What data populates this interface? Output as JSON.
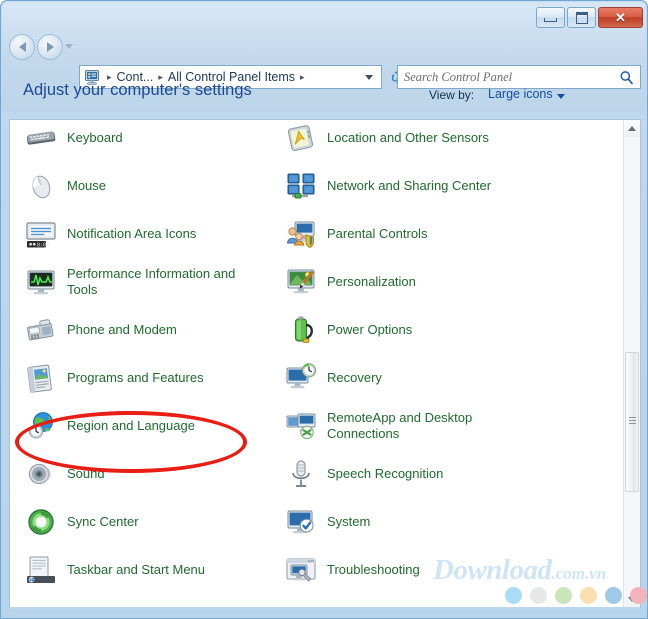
{
  "window": {
    "frame_color": "#bcd6ec",
    "border_color": "#6fa8d4",
    "buttons": {
      "minimize_label": "Minimize",
      "maximize_label": "Maximize",
      "close_label": "✕"
    }
  },
  "navigation": {
    "back_label": "Back",
    "forward_label": "Forward",
    "recent_pages_label": "Recent pages",
    "refresh_label": "Refresh",
    "breadcrumb": {
      "icon": "control-panel-icon",
      "separator": "▸",
      "items": [
        {
          "label": "Cont..."
        },
        {
          "label": "All Control Panel Items"
        }
      ]
    },
    "address_dropdown_label": "Previous locations"
  },
  "search": {
    "placeholder": "Search Control Panel",
    "icon": "search-icon"
  },
  "header": {
    "title": "Adjust your computer's settings",
    "view_by_label": "View by:",
    "view_by_value": "Large icons",
    "view_by_caret": "▾",
    "title_color": "#1b4a91",
    "link_color": "#12519e"
  },
  "content": {
    "item_label_color": "#1f6b2e",
    "items": [
      {
        "label": "Keyboard",
        "icon": "keyboard-icon",
        "column": "left"
      },
      {
        "label": "Location and Other Sensors",
        "icon": "location-sensor-icon",
        "column": "right"
      },
      {
        "label": "Mouse",
        "icon": "mouse-icon",
        "column": "left"
      },
      {
        "label": "Network and Sharing Center",
        "icon": "network-sharing-icon",
        "column": "right"
      },
      {
        "label": "Notification Area Icons",
        "icon": "notification-area-icon",
        "column": "left"
      },
      {
        "label": "Parental Controls",
        "icon": "parental-controls-icon",
        "column": "right"
      },
      {
        "label": "Performance Information and Tools",
        "icon": "performance-icon",
        "column": "left"
      },
      {
        "label": "Personalization",
        "icon": "personalization-icon",
        "column": "right"
      },
      {
        "label": "Phone and Modem",
        "icon": "phone-modem-icon",
        "column": "left"
      },
      {
        "label": "Power Options",
        "icon": "power-options-icon",
        "column": "right"
      },
      {
        "label": "Programs and Features",
        "icon": "programs-features-icon",
        "column": "left"
      },
      {
        "label": "Recovery",
        "icon": "recovery-icon",
        "column": "right"
      },
      {
        "label": "Region and Language",
        "icon": "region-language-icon",
        "column": "left"
      },
      {
        "label": "RemoteApp and Desktop Connections",
        "icon": "remoteapp-icon",
        "column": "right"
      },
      {
        "label": "Sound",
        "icon": "sound-icon",
        "column": "left"
      },
      {
        "label": "Speech Recognition",
        "icon": "speech-recognition-icon",
        "column": "right"
      },
      {
        "label": "Sync Center",
        "icon": "sync-center-icon",
        "column": "left"
      },
      {
        "label": "System",
        "icon": "system-icon",
        "column": "right"
      },
      {
        "label": "Taskbar and Start Menu",
        "icon": "taskbar-start-menu-icon",
        "column": "left"
      },
      {
        "label": "Troubleshooting",
        "icon": "troubleshooting-icon",
        "column": "right"
      }
    ]
  },
  "scrollbar": {
    "up_arrow_label": "Scroll up",
    "down_arrow_label": "Scroll down",
    "thumb_label": "Scroll thumb"
  },
  "annotation": {
    "shape": "ellipse",
    "color": "#e81d14",
    "targets_item": "Region and Language"
  },
  "watermark": {
    "main_text": "Download",
    "suffix_text": ".com.vn",
    "color": "#cfe4f5",
    "dots": [
      "#a9dcf5",
      "#e6e8e8",
      "#c8e6b8",
      "#fadfb0",
      "#9ec9e8",
      "#f3b3bd"
    ]
  }
}
